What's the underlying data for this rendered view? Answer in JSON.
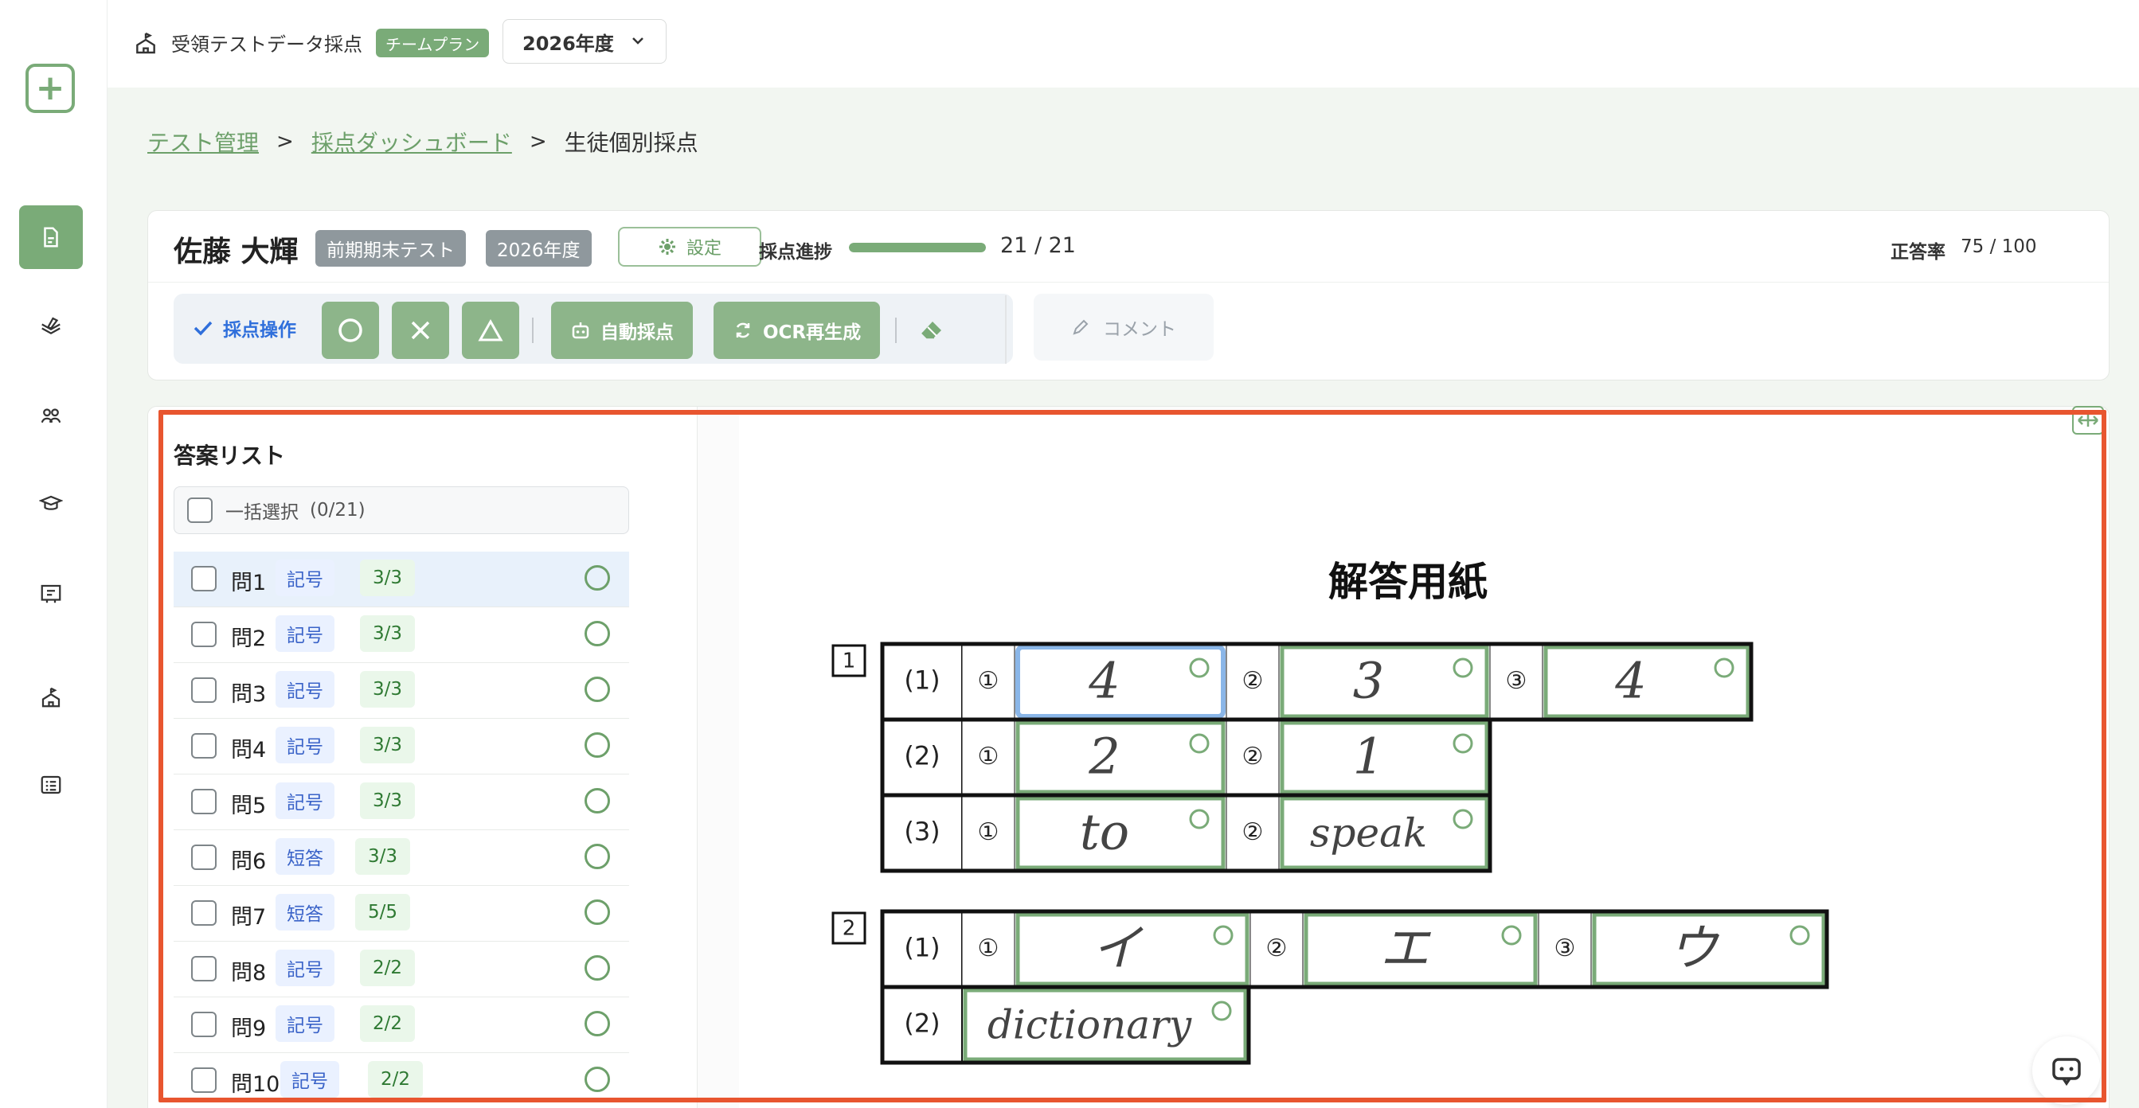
{
  "topbar": {
    "school_name": "受領テストデータ採点",
    "plan_badge": "チームプラン",
    "year_select": "2026年度"
  },
  "breadcrumb": {
    "test_management": "テスト管理",
    "dashboard": "採点ダッシュボード",
    "current": "生徒個別採点"
  },
  "student": {
    "name": "佐藤 大輝",
    "test_badge": "前期期末テスト",
    "year_badge": "2026年度",
    "settings_label": "設定"
  },
  "progress": {
    "label": "採点進捗",
    "text": "21 / 21",
    "fraction": 1.0
  },
  "accuracy": {
    "label": "正答率",
    "value": "75 / 100"
  },
  "toolbar": {
    "grading_ops": "採点操作",
    "auto_grade": "自動採点",
    "ocr_regen": "OCR再生成",
    "comment": "コメント"
  },
  "list": {
    "title": "答案リスト",
    "bulk_select": "一括選択",
    "bulk_count": "(0/21)",
    "rows": [
      {
        "label": "問1",
        "type": "記号",
        "score": "3/3"
      },
      {
        "label": "問2",
        "type": "記号",
        "score": "3/3"
      },
      {
        "label": "問3",
        "type": "記号",
        "score": "3/3"
      },
      {
        "label": "問4",
        "type": "記号",
        "score": "3/3"
      },
      {
        "label": "問5",
        "type": "記号",
        "score": "3/3"
      },
      {
        "label": "問6",
        "type": "短答",
        "score": "3/3"
      },
      {
        "label": "問7",
        "type": "短答",
        "score": "5/5"
      },
      {
        "label": "問8",
        "type": "記号",
        "score": "2/2"
      },
      {
        "label": "問9",
        "type": "記号",
        "score": "2/2"
      },
      {
        "label": "問10",
        "type": "記号",
        "score": "2/2"
      }
    ]
  },
  "sheet": {
    "title": "解答用紙",
    "sections": [
      {
        "number": "1",
        "rows": [
          {
            "label": "(1)",
            "cells": [
              {
                "num": "①",
                "answer": "4"
              },
              {
                "num": "②",
                "answer": "3"
              },
              {
                "num": "③",
                "answer": "4"
              }
            ]
          },
          {
            "label": "(2)",
            "cells": [
              {
                "num": "①",
                "answer": "2"
              },
              {
                "num": "②",
                "answer": "1"
              }
            ]
          },
          {
            "label": "(3)",
            "cells": [
              {
                "num": "①",
                "answer": "to"
              },
              {
                "num": "②",
                "answer": "speak"
              }
            ]
          }
        ]
      },
      {
        "number": "2",
        "rows": [
          {
            "label": "(1)",
            "cells": [
              {
                "num": "①",
                "answer": "イ"
              },
              {
                "num": "②",
                "answer": "エ"
              },
              {
                "num": "③",
                "answer": "ウ"
              }
            ]
          },
          {
            "label": "(2)",
            "cells": [
              {
                "num": "",
                "answer": "dictionary"
              }
            ]
          }
        ]
      }
    ]
  },
  "colors": {
    "accent": "#7aab78",
    "highlight": "#e8552f",
    "link": "#6da06a",
    "selected_row": "#e8f1fb"
  }
}
